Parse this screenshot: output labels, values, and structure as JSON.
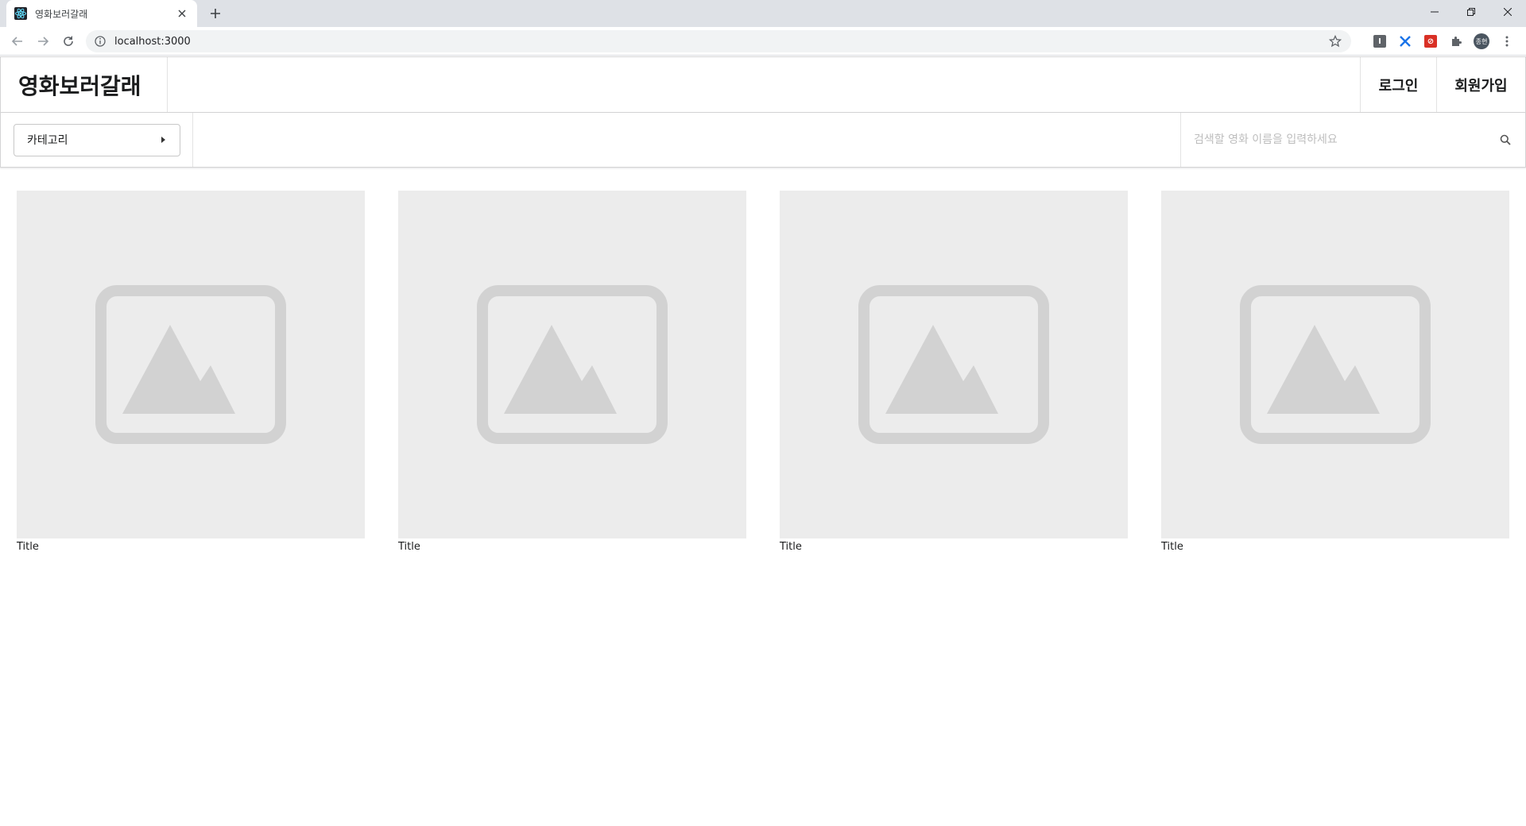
{
  "browser": {
    "tab_title": "영화보러갈래",
    "url": "localhost:3000",
    "profile_initials": "종현"
  },
  "header": {
    "brand": "영화보러갈래",
    "login": "로그인",
    "signup": "회원가입"
  },
  "subbar": {
    "category_label": "카테고리",
    "search_placeholder": "검색할 영화 이름을 입력하세요"
  },
  "movies": [
    {
      "title": "Title"
    },
    {
      "title": "Title"
    },
    {
      "title": "Title"
    },
    {
      "title": "Title"
    }
  ]
}
